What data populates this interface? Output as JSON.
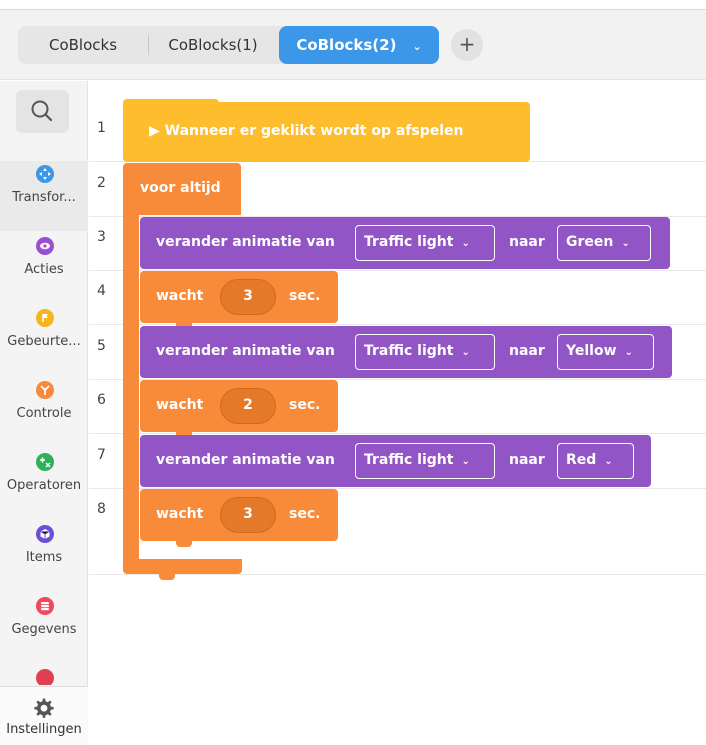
{
  "tabs": {
    "items": [
      {
        "label": "CoBlocks"
      },
      {
        "label": "CoBlocks(1)"
      },
      {
        "label": "CoBlocks(2)"
      }
    ],
    "active_chevron": "⌄",
    "add_label": "+"
  },
  "sidebar": {
    "search_icon": "search-icon",
    "categories": [
      {
        "label": "Transfor...",
        "color": "#3d97e8",
        "icon": "move-icon"
      },
      {
        "label": "Acties",
        "color": "#9b4fd0",
        "icon": "eye-icon"
      },
      {
        "label": "Gebeurte...",
        "color": "#f7b51c",
        "icon": "flag-icon"
      },
      {
        "label": "Controle",
        "color": "#f7893a",
        "icon": "branch-icon"
      },
      {
        "label": "Operatoren",
        "color": "#2fb15a",
        "icon": "operator-icon"
      },
      {
        "label": "Items",
        "color": "#6b4fd6",
        "icon": "cube-icon"
      },
      {
        "label": "Gegevens",
        "color": "#f0495b",
        "icon": "database-icon"
      }
    ],
    "settings_label": "Instellingen"
  },
  "editor": {
    "line_numbers": [
      "1",
      "2",
      "3",
      "4",
      "5",
      "6",
      "7",
      "8"
    ],
    "event_block": "▶ Wanneer er geklikt wordt op afspelen",
    "loop_block": "voor altijd",
    "actions": [
      {
        "label": "verander animatie van",
        "object": "Traffic light",
        "to_label": "naar",
        "value": "Green"
      },
      {
        "label": "verander animatie van",
        "object": "Traffic light",
        "to_label": "naar",
        "value": "Yellow"
      },
      {
        "label": "verander animatie van",
        "object": "Traffic light",
        "to_label": "naar",
        "value": "Red"
      }
    ],
    "waits": [
      {
        "label": "wacht",
        "value": "3",
        "unit": "sec."
      },
      {
        "label": "wacht",
        "value": "2",
        "unit": "sec."
      },
      {
        "label": "wacht",
        "value": "3",
        "unit": "sec."
      }
    ],
    "dropdown_chevron": "⌄"
  },
  "colors": {
    "event": "#fdbd2c",
    "control": "#f78b3a",
    "action": "#9255c5",
    "active_tab": "#3d97e8"
  }
}
